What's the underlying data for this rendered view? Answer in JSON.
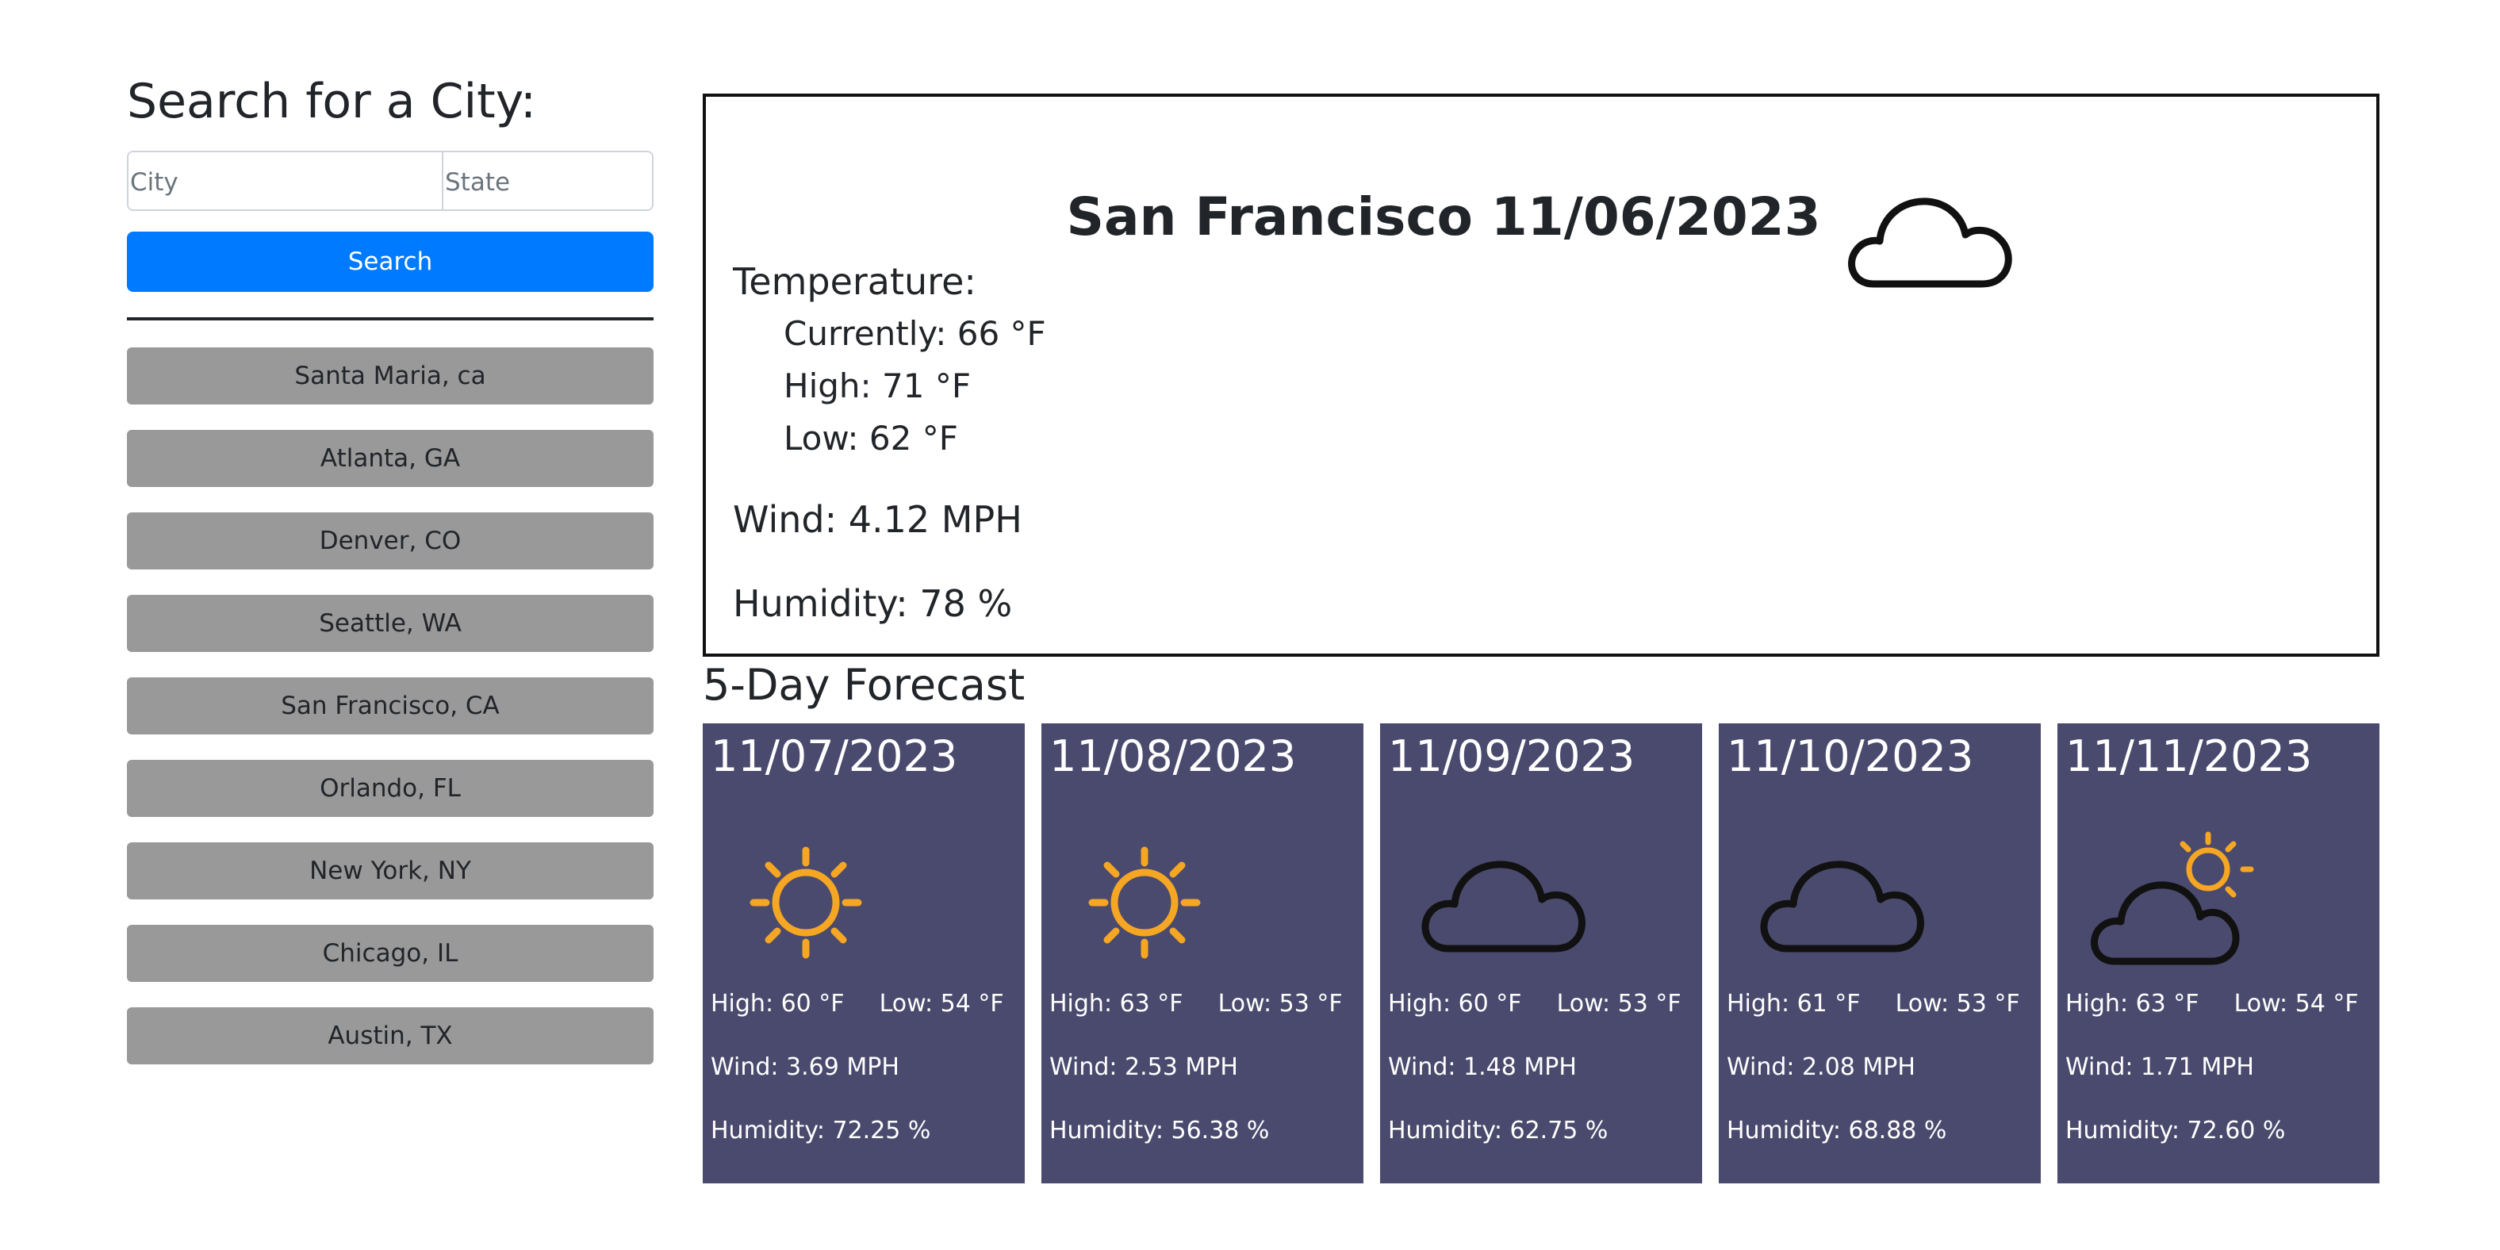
{
  "sidebar": {
    "heading": "Search for a City:",
    "city_placeholder": "City",
    "state_placeholder": "State",
    "search_label": "Search",
    "history": [
      "Santa Maria, ca",
      "Atlanta, GA",
      "Denver, CO",
      "Seattle, WA",
      "San Francisco, CA",
      "Orlando, FL",
      "New York, NY",
      "Chicago, IL",
      "Austin, TX"
    ]
  },
  "current": {
    "title": "San Francisco 11/06/2023",
    "icon": "cloud-icon",
    "temperature_label": "Temperature:",
    "currently": "Currently: 66 °F",
    "high": "High: 71 °F",
    "low": "Low: 62 °F",
    "wind": "Wind: 4.12 MPH",
    "humidity": "Humidity: 78 %"
  },
  "forecast": {
    "title": "5-Day Forecast",
    "days": [
      {
        "date": "11/07/2023",
        "icon": "sun-icon",
        "high": "High: 60 °F",
        "low": "Low: 54 °F",
        "wind": "Wind: 3.69 MPH",
        "humidity": "Humidity: 72.25 %"
      },
      {
        "date": "11/08/2023",
        "icon": "sun-icon",
        "high": "High: 63 °F",
        "low": "Low: 53 °F",
        "wind": "Wind: 2.53 MPH",
        "humidity": "Humidity: 56.38 %"
      },
      {
        "date": "11/09/2023",
        "icon": "cloud-icon",
        "high": "High: 60 °F",
        "low": "Low: 53 °F",
        "wind": "Wind: 1.48 MPH",
        "humidity": "Humidity: 62.75 %"
      },
      {
        "date": "11/10/2023",
        "icon": "cloud-icon",
        "high": "High: 61 °F",
        "low": "Low: 53 °F",
        "wind": "Wind: 2.08 MPH",
        "humidity": "Humidity: 68.88 %"
      },
      {
        "date": "11/11/2023",
        "icon": "partly-cloudy-icon",
        "high": "High: 63 °F",
        "low": "Low: 54 °F",
        "wind": "Wind: 1.71 MPH",
        "humidity": "Humidity: 72.60 %"
      }
    ]
  },
  "colors": {
    "search_button": "#007bff",
    "history_button": "#999999",
    "forecast_card": "#4a4a6e",
    "sun": "#f5a623"
  }
}
